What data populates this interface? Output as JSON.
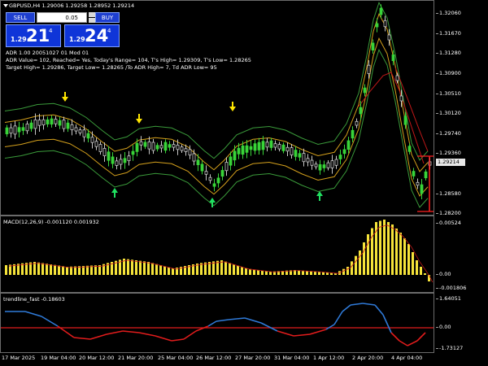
{
  "chart_title": "GBPUSD,H4  1.29006 1.29258 1.28952 1.29214",
  "trade_panel": {
    "sell_label": "SELL",
    "buy_label": "BUY",
    "lot_value": "0.05",
    "sell_small": "1.29",
    "sell_big": "21",
    "sell_sup": "4",
    "buy_small": "1.29",
    "buy_big": "24",
    "buy_sup": "4"
  },
  "adr_info": [
    "ADR 1.00 20051027 01 Mod 01",
    "ADR Value= 102, Reached= Yes, Today's Range= 104, T's High= 1.29309, T's Low= 1.28265",
    "Target High= 1.29286, Target Low= 1.28265 /To ADR High= 7, Td ADR Low= 95"
  ],
  "price_axis": [
    "1.32060",
    "1.31670",
    "1.31280",
    "1.30900",
    "1.30510",
    "1.30120",
    "1.29740",
    "1.29360",
    "1.28580",
    "1.28200"
  ],
  "current_price": "1.29214",
  "macd_label": "MACD(12,26,9) -0.001120 0.001932",
  "macd_axis": [
    "0.00524",
    "0.00",
    "-0.001806"
  ],
  "trend_label": "trendline_fast -0.18603",
  "trend_axis": [
    "1.64051",
    "0.00",
    "-1.73127"
  ],
  "time_axis": [
    "17 Mar 2025",
    "19 Mar 04:00",
    "20 Mar 12:00",
    "21 Mar 20:00",
    "25 Mar 04:00",
    "26 Mar 12:00",
    "27 Mar 20:00",
    "31 Mar 04:00",
    "1 Apr 12:00",
    "2 Apr 20:00",
    "4 Apr 04:00"
  ],
  "colors": {
    "bull": "#39d439",
    "bear": "#c8c8c8",
    "macd_hist": "#f5e33a",
    "band_outer": "#3a9a3a",
    "band_mid": "#d4a01c",
    "ma_red": "#c01818",
    "trend_blue": "#2f7ad8",
    "trend_red": "#e01c1c",
    "price_tag": "#e0e0e0",
    "adr_red": "#ff2020",
    "arrow_yellow": "#ffe600",
    "arrow_green": "#20e060"
  }
}
